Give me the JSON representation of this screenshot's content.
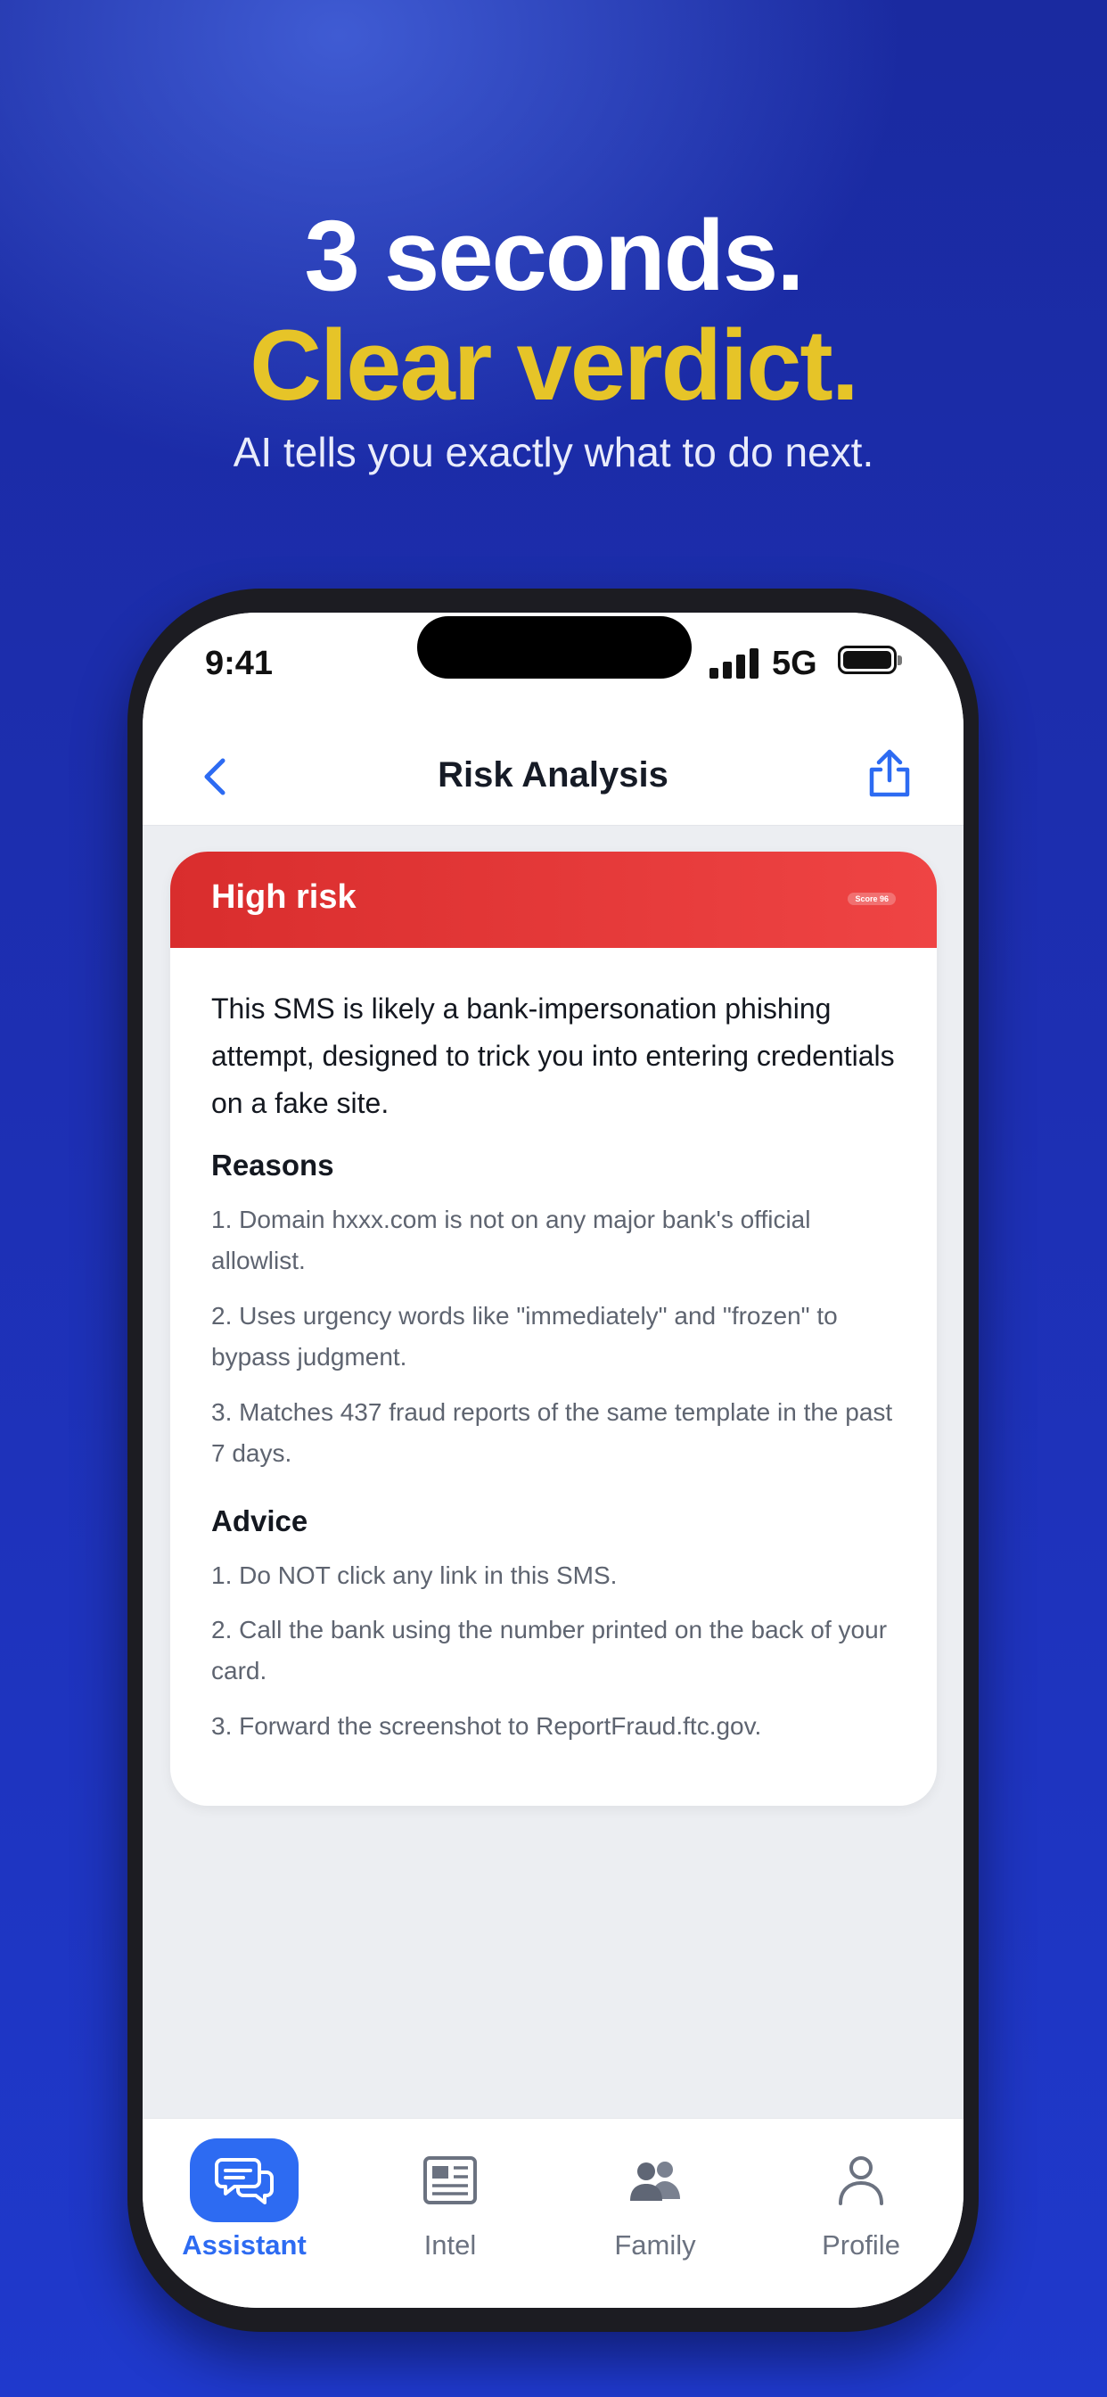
{
  "hero": {
    "line1": "3 seconds.",
    "line2": "Clear verdict.",
    "subtitle": "AI tells you exactly what to do next."
  },
  "status_bar": {
    "time": "9:41",
    "network": "5G"
  },
  "nav": {
    "title": "Risk Analysis",
    "back_icon": "chevron-left-icon",
    "share_icon": "share-icon"
  },
  "card": {
    "risk_label": "High risk",
    "score_label": "Score 96",
    "summary": "This SMS is likely a bank-impersonation phishing attempt, designed to trick you into entering credentials on a fake site.",
    "reasons_title": "Reasons",
    "reasons": [
      "1. Domain hxxx.com is not on any major bank's official allowlist.",
      "2. Uses urgency words like \"immediately\" and \"frozen\" to bypass judgment.",
      "3. Matches 437 fraud reports of the same template in the past 7 days."
    ],
    "advice_title": "Advice",
    "advice": [
      "1. Do NOT click any link in this SMS.",
      "2. Call the bank using the number printed on the back of your card.",
      "3. Forward the screenshot to ReportFraud.ftc.gov."
    ]
  },
  "tabs": [
    {
      "label": "Assistant",
      "icon": "chat-bubbles-icon",
      "active": true
    },
    {
      "label": "Intel",
      "icon": "newspaper-icon",
      "active": false
    },
    {
      "label": "Family",
      "icon": "people-icon",
      "active": false
    },
    {
      "label": "Profile",
      "icon": "person-icon",
      "active": false
    }
  ],
  "colors": {
    "accent": "#2d6bf2",
    "risk": "#e53535",
    "headline_yellow": "#e6c428"
  }
}
